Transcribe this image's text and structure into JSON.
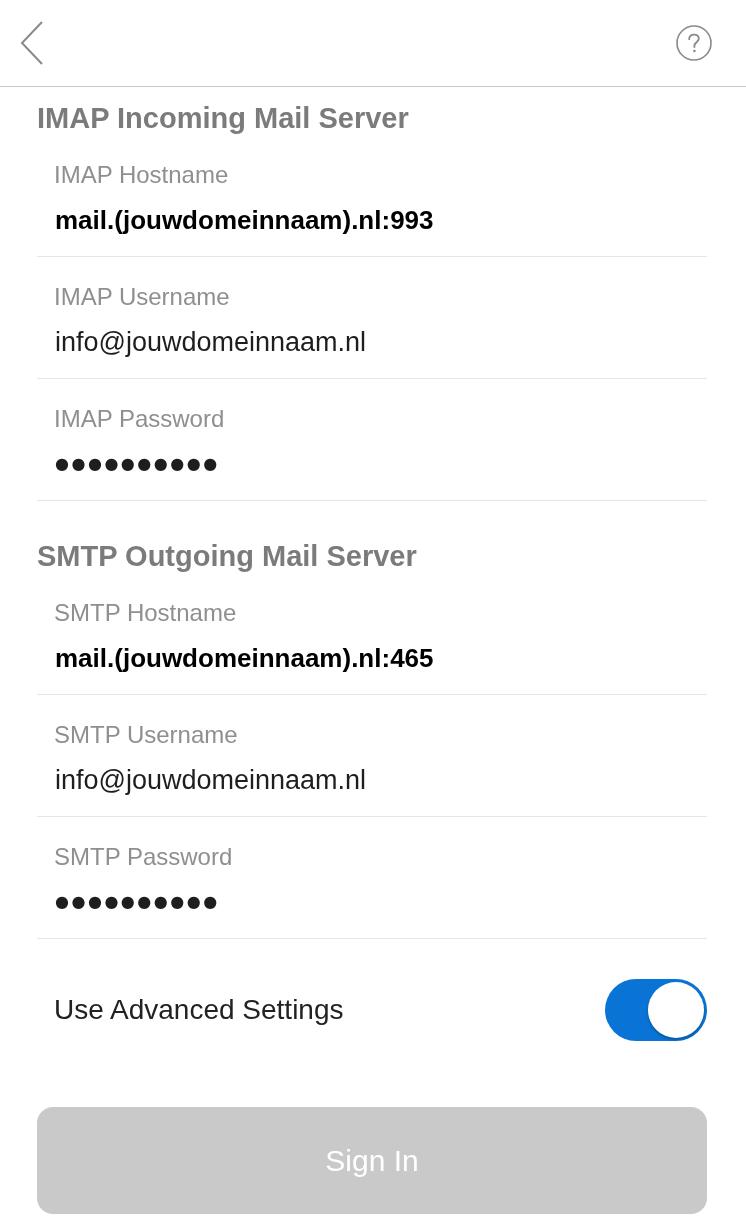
{
  "sections": [
    {
      "title": "IMAP Incoming Mail Server",
      "fields": [
        {
          "label": "IMAP Hostname",
          "value": "mail.(jouwdomeinnaam).nl:993",
          "kind": "text",
          "bold": true
        },
        {
          "label": "IMAP Username",
          "value": "info@jouwdomeinnaam.nl",
          "kind": "text",
          "bold": false
        },
        {
          "label": "IMAP Password",
          "value": "●●●●●●●●●●",
          "kind": "password",
          "bold": false
        }
      ]
    },
    {
      "title": "SMTP Outgoing Mail Server",
      "fields": [
        {
          "label": "SMTP Hostname",
          "value": "mail.(jouwdomeinnaam).nl:465",
          "kind": "text",
          "bold": true
        },
        {
          "label": "SMTP Username",
          "value": "info@jouwdomeinnaam.nl",
          "kind": "text",
          "bold": false
        },
        {
          "label": "SMTP Password",
          "value": "●●●●●●●●●●",
          "kind": "password",
          "bold": false
        }
      ]
    }
  ],
  "advanced_settings": {
    "label": "Use Advanced Settings",
    "on": true
  },
  "sign_in_button": {
    "label": "Sign In",
    "disabled": true
  }
}
